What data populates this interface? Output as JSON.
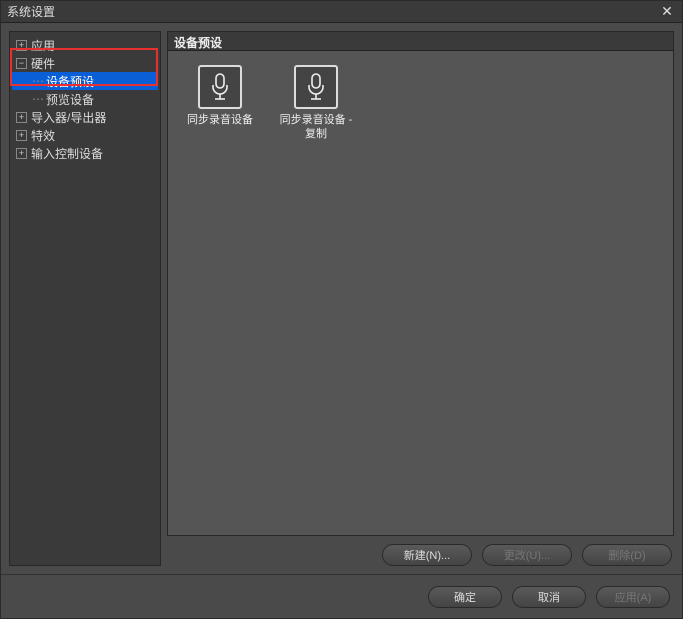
{
  "window": {
    "title": "系统设置",
    "close": "✕"
  },
  "tree": {
    "app": "应用",
    "hardware": "硬件",
    "device_preset": "设备预设",
    "preview_device": "预览设备",
    "importer_exporter": "导入器/导出器",
    "effects": "特效",
    "input_control": "输入控制设备"
  },
  "section": {
    "title": "设备预设"
  },
  "presets": [
    {
      "label": "同步录音设备"
    },
    {
      "label": "同步录音设备 - 复制"
    }
  ],
  "buttons": {
    "new": "新建(N)...",
    "change": "更改(U)...",
    "delete": "删除(D)",
    "ok": "确定",
    "cancel": "取消",
    "apply": "应用(A)"
  }
}
